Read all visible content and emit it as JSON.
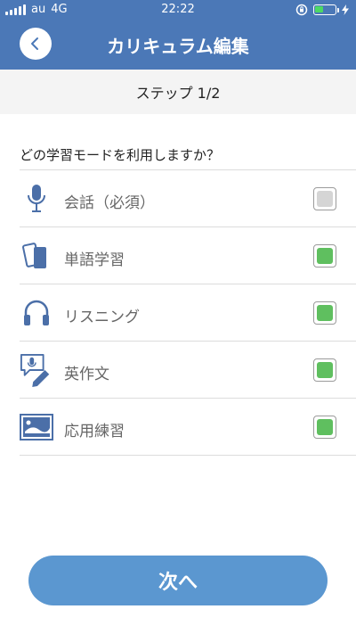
{
  "status_bar": {
    "carrier": "au",
    "network": "4G",
    "time": "22:22"
  },
  "header": {
    "title": "カリキュラム編集",
    "back_icon": "chevron-left-icon"
  },
  "step": {
    "label": "ステップ 1/2"
  },
  "question": "どの学習モードを利用しますか？",
  "modes": [
    {
      "label": "会話（必須）",
      "icon": "microphone-icon",
      "checked": true,
      "disabled": true
    },
    {
      "label": "単語学習",
      "icon": "cards-icon",
      "checked": true,
      "disabled": false
    },
    {
      "label": "リスニング",
      "icon": "headphones-icon",
      "checked": true,
      "disabled": false
    },
    {
      "label": "英作文",
      "icon": "speech-pencil-icon",
      "checked": true,
      "disabled": false
    },
    {
      "label": "応用練習",
      "icon": "image-icon",
      "checked": true,
      "disabled": false
    }
  ],
  "next_button": {
    "label": "次へ"
  },
  "colors": {
    "primary": "#4b78b7",
    "button": "#5b97d0",
    "check_on": "#5fbf5f",
    "check_disabled": "#d5d5d5",
    "icon": "#4b6fa8"
  }
}
